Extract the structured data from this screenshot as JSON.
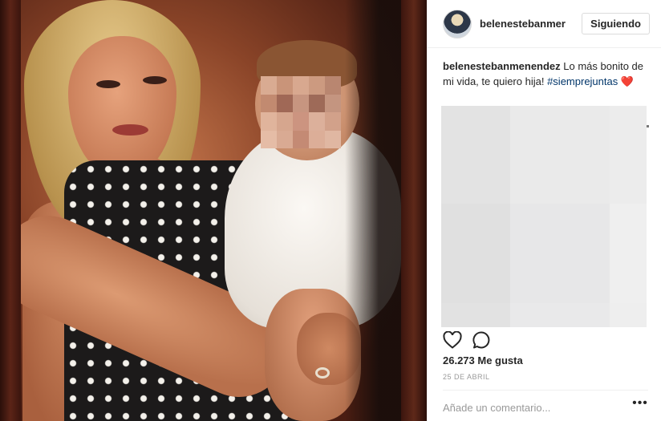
{
  "post": {
    "username": "belenestebanmenendez",
    "header_username": "belenestebanmer",
    "follow_label": "Siguiendo",
    "caption_text": "Lo más bonito de mi vida, te quiero hija!",
    "hashtag": "#siemprejuntas",
    "caption_emoji": "❤️",
    "likes": "26.273 Me gusta",
    "date": "25 DE ABRIL",
    "comment_placeholder": "Añade un comentario...",
    "more_label": "•••"
  },
  "colors": {
    "link": "#003569",
    "text": "#262626",
    "muted": "#999999",
    "border": "#dbdbdb"
  },
  "icons": [
    "heart-icon",
    "comment-icon",
    "more-options-icon"
  ]
}
